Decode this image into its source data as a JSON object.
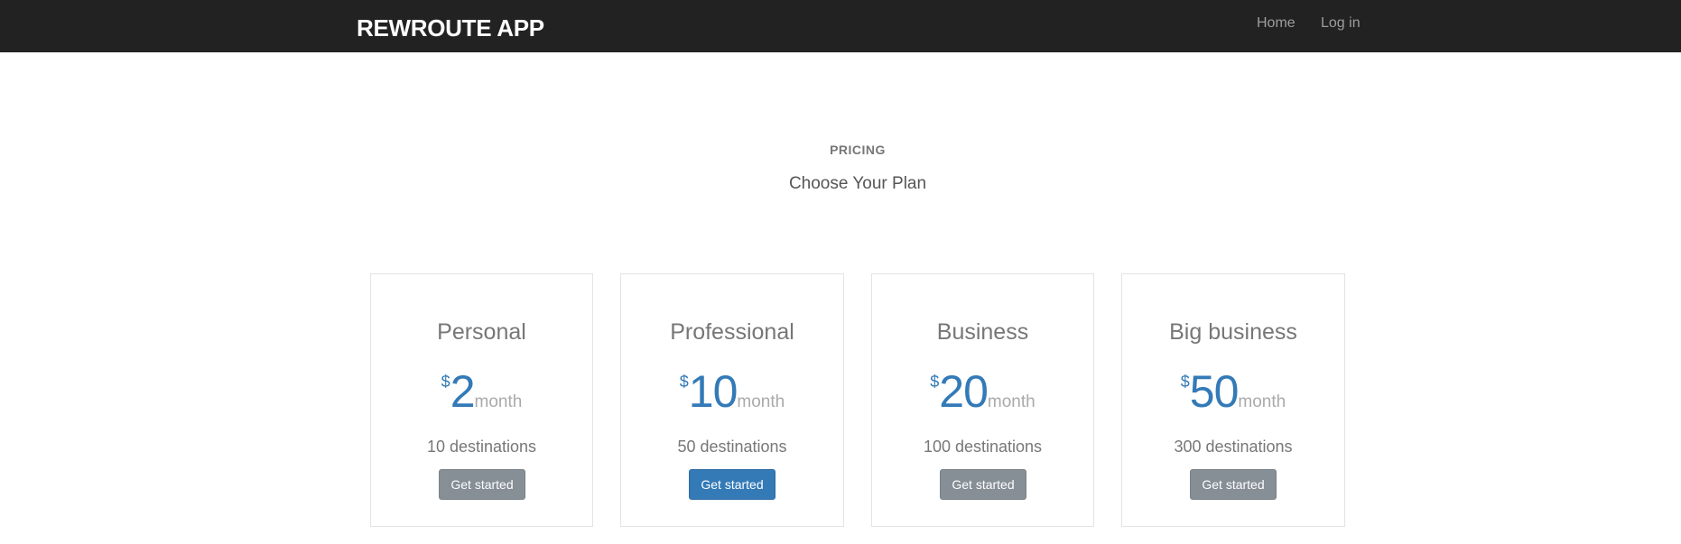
{
  "navbar": {
    "brand": "REWROUTE APP",
    "links": [
      "Home",
      "Log in"
    ]
  },
  "pricing": {
    "label": "PRICING",
    "title": "Choose Your Plan"
  },
  "plans": [
    {
      "name": "Personal",
      "currency": "$",
      "price": "2",
      "period": "month",
      "destinations": "10 destinations",
      "cta": "Get started",
      "highlighted": false
    },
    {
      "name": "Professional",
      "currency": "$",
      "price": "10",
      "period": "month",
      "destinations": "50 destinations",
      "cta": "Get started",
      "highlighted": true
    },
    {
      "name": "Business",
      "currency": "$",
      "price": "20",
      "period": "month",
      "destinations": "100 destinations",
      "cta": "Get started",
      "highlighted": false
    },
    {
      "name": "Big business",
      "currency": "$",
      "price": "50",
      "period": "month",
      "destinations": "300 destinations",
      "cta": "Get started",
      "highlighted": false
    }
  ],
  "colors": {
    "navbar_bg": "#222222",
    "accent": "#337ab7",
    "button_default": "#868e96"
  }
}
